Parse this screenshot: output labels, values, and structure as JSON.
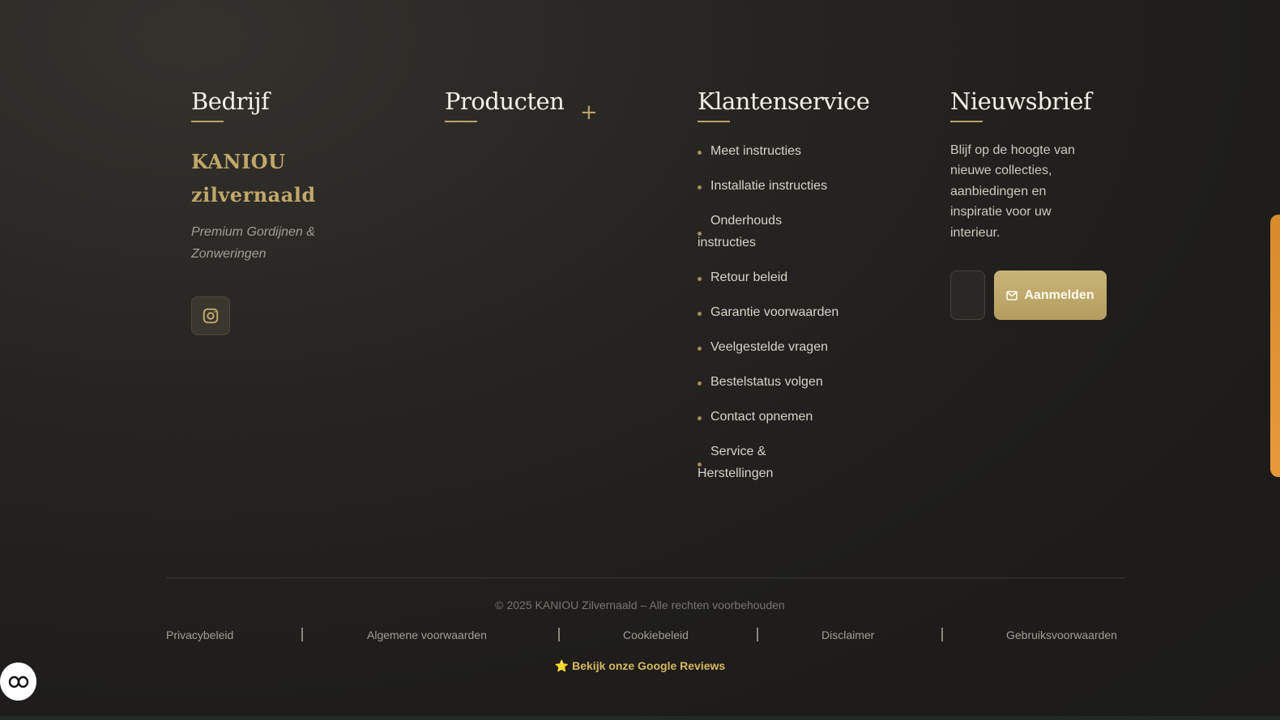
{
  "company": {
    "title": "Bedrijf",
    "brand_line1": "KANIOU",
    "brand_line2": "zilvernaald",
    "tagline_line1": "Premium Gordijnen &",
    "tagline_line2": "Zonweringen",
    "social_icon": "instagram-icon"
  },
  "products": {
    "title": "Producten",
    "toggle_icon": "+"
  },
  "service": {
    "title": "Klantenservice",
    "items": [
      [
        "Meet instructies"
      ],
      [
        "Installatie instructies"
      ],
      [
        "Onderhouds",
        "instructies"
      ],
      [
        "Retour beleid"
      ],
      [
        "Garantie voorwaarden"
      ],
      [
        "Veelgestelde vragen"
      ],
      [
        "Bestelstatus volgen"
      ],
      [
        "Contact opnemen"
      ],
      [
        "Service &",
        "Herstellingen"
      ]
    ]
  },
  "newsletter": {
    "title": "Nieuwsbrief",
    "text_lines": [
      "Blijf op de hoogte van",
      "nieuwe collecties,",
      "aanbiedingen en",
      "inspiratie voor uw",
      "interieur."
    ],
    "email_value": "",
    "button_label": "Aanmelden",
    "button_icon": "mail-icon"
  },
  "bottom": {
    "copyright": "© 2025 KANIOU Zilvernaald – Alle rechten voorbehouden",
    "links": [
      "Privacybeleid",
      "Algemene voorwaarden",
      "Cookiebeleid",
      "Disclaimer",
      "Gebruiksvoorwaarden"
    ],
    "reviews_icon": "⭐",
    "reviews_label": "Bekijk onze Google Reviews"
  },
  "colors": {
    "accent_gold": "#b9a468",
    "button_gold": "#c2ad70",
    "side_tab_orange": "#e0932f",
    "background": "#1f1e1c"
  }
}
